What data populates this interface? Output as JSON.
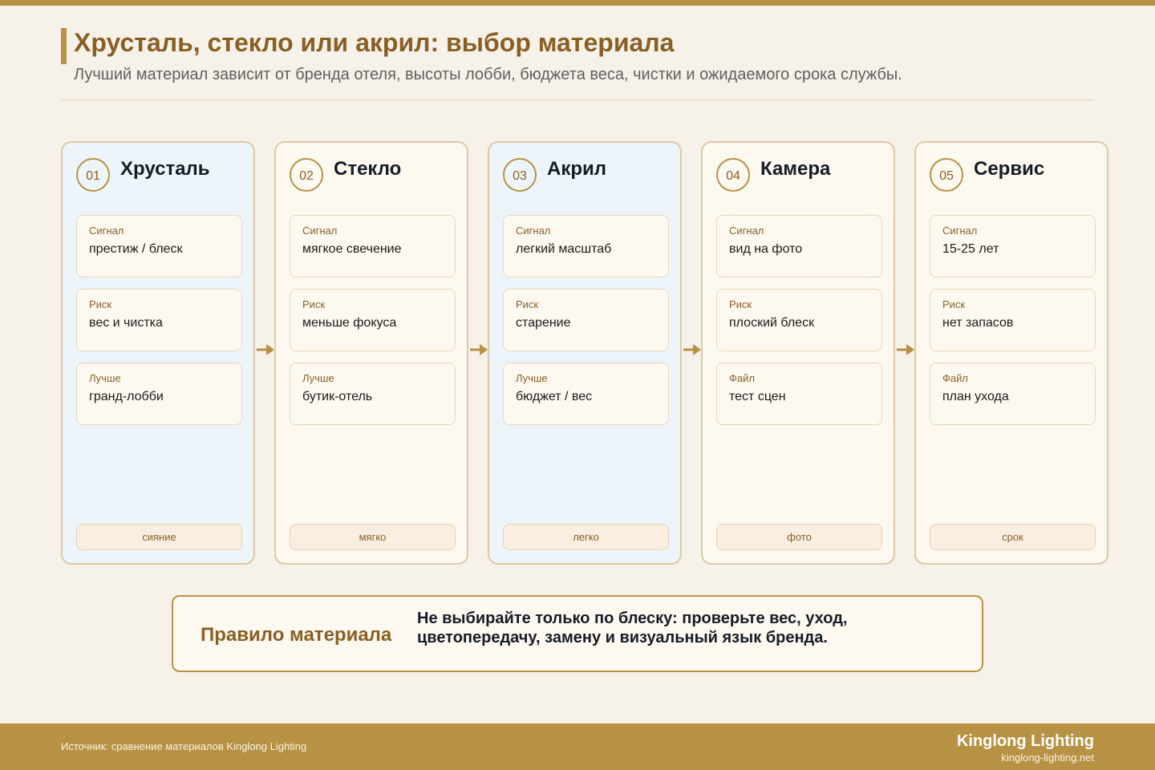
{
  "header": {
    "title": "Хрусталь, стекло или акрил: выбор материала",
    "subtitle": "Лучший материал зависит от бренда отеля, высоты лобби, бюджета веса, чистки и ожидаемого срока службы."
  },
  "colors": {
    "accent": "#b79245",
    "heading": "#8a5f24",
    "panel_blue": "#eef5fa",
    "panel_cream": "#fdf9f1",
    "background": "#f6f2ea"
  },
  "columns": [
    {
      "number": "01",
      "title": "Хрусталь",
      "tint": "blue",
      "cards": [
        {
          "label": "Сигнал",
          "value": "престиж / блеск"
        },
        {
          "label": "Риск",
          "value": "вес и чистка"
        },
        {
          "label": "Лучше",
          "value": "гранд-лобби"
        }
      ],
      "tag": "сияние"
    },
    {
      "number": "02",
      "title": "Стекло",
      "tint": "cream",
      "cards": [
        {
          "label": "Сигнал",
          "value": "мягкое свечение"
        },
        {
          "label": "Риск",
          "value": "меньше фокуса"
        },
        {
          "label": "Лучше",
          "value": "бутик-отель"
        }
      ],
      "tag": "мягко"
    },
    {
      "number": "03",
      "title": "Акрил",
      "tint": "blue",
      "cards": [
        {
          "label": "Сигнал",
          "value": "легкий масштаб"
        },
        {
          "label": "Риск",
          "value": "старение"
        },
        {
          "label": "Лучше",
          "value": "бюджет / вес"
        }
      ],
      "tag": "легко"
    },
    {
      "number": "04",
      "title": "Камера",
      "tint": "cream",
      "cards": [
        {
          "label": "Сигнал",
          "value": "вид на фото"
        },
        {
          "label": "Риск",
          "value": "плоский блеск"
        },
        {
          "label": "Файл",
          "value": "тест сцен"
        }
      ],
      "tag": "фото"
    },
    {
      "number": "05",
      "title": "Сервис",
      "tint": "cream",
      "cards": [
        {
          "label": "Сигнал",
          "value": "15-25 лет"
        },
        {
          "label": "Риск",
          "value": "нет запасов"
        },
        {
          "label": "Файл",
          "value": "план ухода"
        }
      ],
      "tag": "срок"
    }
  ],
  "rule": {
    "label": "Правило материала",
    "text": "Не выбирайте только по блеску: проверьте вес, уход, цветопередачу, замену и визуальный язык бренда."
  },
  "footer": {
    "source": "Источник: сравнение материалов Kinglong Lighting",
    "brand": "Kinglong Lighting",
    "url": "kinglong-lighting.net"
  }
}
